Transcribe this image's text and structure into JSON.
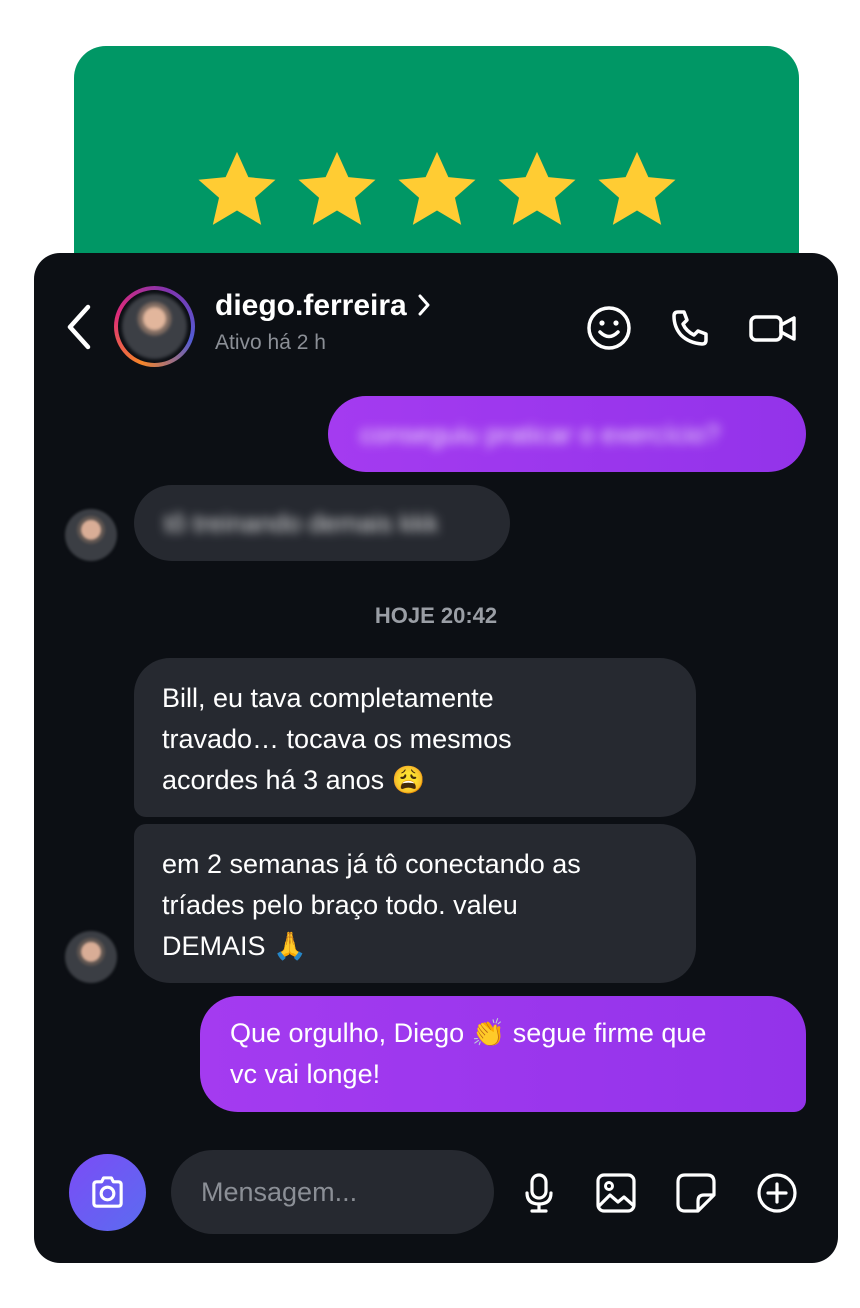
{
  "rating": {
    "stars_filled": 5,
    "stars_total": 5,
    "card_color": "#009765",
    "star_color": "#FFCC33"
  },
  "header": {
    "username": "diego.ferreira",
    "status": "Ativo há 2 h",
    "icons": [
      "back-chevron-icon",
      "smile-icon",
      "phone-icon",
      "video-camera-icon"
    ]
  },
  "messages": {
    "outgoing_blurred": "conseguiu praticar o exercício?",
    "incoming_blurred": "tô treinando demais kkk",
    "timestamp": "HOJE 20:42",
    "incoming_1": "Bill, eu tava completamente\ntravado… tocava os mesmos\nacordes há 3 anos 😩",
    "incoming_2": "em 2 semanas já tô conectando as\ntríades pelo braço todo. valeu\nDEMAIS 🙏",
    "outgoing_reply": "Que orgulho, Diego 👏 segue firme que\nvc vai longe!"
  },
  "composer": {
    "placeholder": "Mensagem...",
    "icons": [
      "camera-icon",
      "microphone-icon",
      "gallery-icon",
      "sticker-icon",
      "plus-circle-icon"
    ]
  },
  "colors": {
    "outgoing_bubble": "#9333EA",
    "incoming_bubble": "#262930",
    "background": "#0C0F14"
  }
}
